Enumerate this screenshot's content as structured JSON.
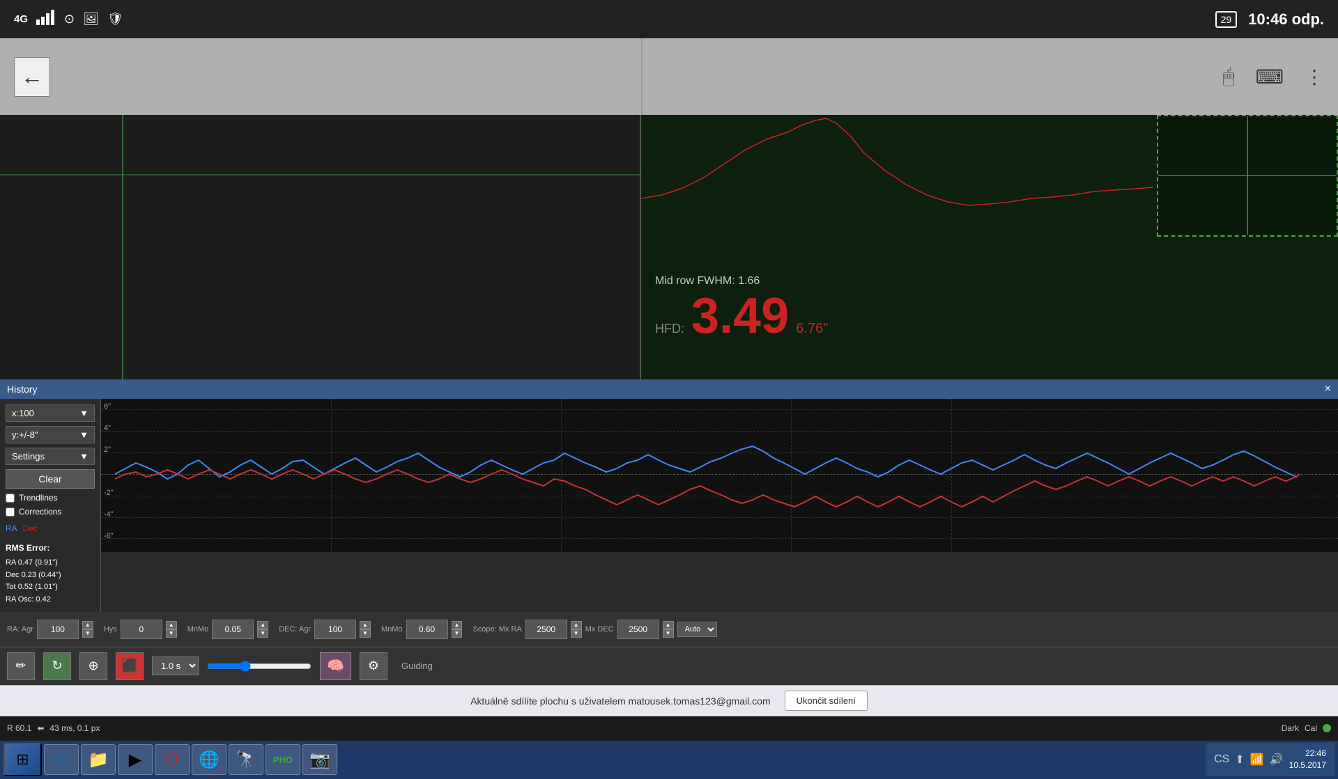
{
  "statusBar": {
    "signal": "4G",
    "battery": "29",
    "time": "10:46",
    "period": "odp."
  },
  "topBar": {
    "backLabel": "←"
  },
  "focusChart": {
    "fwhm_label": "Mid row FWHM: 1.66",
    "hfd_label": "HFD:",
    "hfd_value": "3.49",
    "hfd_unit": "6.76\""
  },
  "history": {
    "title": "History",
    "closeLabel": "×",
    "xScale": "x:100",
    "yScale": "y:+/-8\"",
    "settingsLabel": "Settings",
    "clearLabel": "Clear",
    "trendlines": "Trendlines",
    "corrections": "Corrections",
    "raLabel": "RA",
    "decLabel": "Dec",
    "rmsTitle": "RMS Error:",
    "ra_err": "RA 0.47 (0.91\")",
    "dec_err": "Dec 0.23 (0.44\")",
    "tot_err": "Tot 0.52 (1.01\")",
    "osc_err": "RA Osc: 0.42",
    "yLabels": [
      "6\"",
      "4\"",
      "2\"",
      "",
      "-2\"",
      "-4\"",
      "-6\""
    ]
  },
  "controls": {
    "ra_agr_label": "RA: Agr",
    "ra_agr_val": "100",
    "hys_label": "Hys",
    "hys_val": "0",
    "ra_mnmo_label": "MnMo",
    "ra_mnmo_val": "0.05",
    "dec_label": "DEC: Agr",
    "dec_agr_val": "100",
    "dec_mnmo_label": "MnMo",
    "dec_mnmo_val": "0.60",
    "scope_label": "Scope: Mx RA",
    "mx_ra_val": "2500",
    "mx_dec_label": "Mx DEC",
    "mx_dec_val": "2500",
    "auto_label": "Auto"
  },
  "toolbar": {
    "exposure_val": "1.0 s",
    "guiding_label": "Guiding"
  },
  "notification": {
    "text": "Aktuálně sdílíte plochu s uživatelem matousek.tomas123@gmail.com",
    "btn_label": "Ukončit sdílení"
  },
  "statusBottom": {
    "r_val": "R  60.1",
    "ms_val": "43 ms, 0.1 px",
    "dark_label": "Dark",
    "cal_label": "Cal"
  },
  "taskbar": {
    "datetime": "22:46\n10.5.2017",
    "lang": "CS"
  }
}
